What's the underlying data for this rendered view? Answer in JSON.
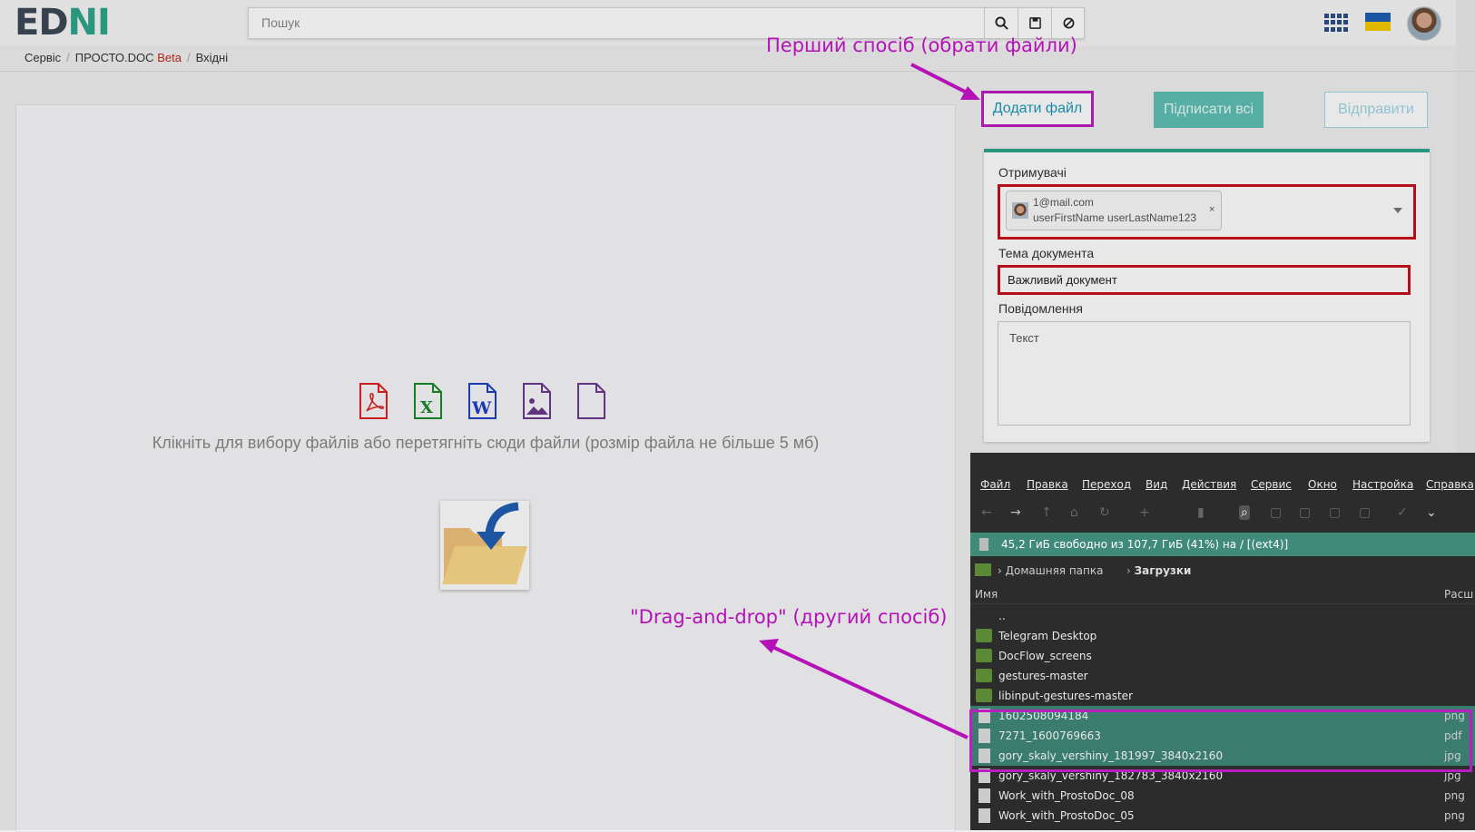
{
  "header": {
    "logo_left": "ED",
    "logo_right": "NI",
    "search_placeholder": "Пошук"
  },
  "breadcrumb": {
    "items": [
      "Сервіс",
      "ПРОСТО.DOC",
      "Вхідні"
    ],
    "beta": "Beta"
  },
  "dropzone": {
    "text": "Клікніть для вибору файлів або перетягніть сюди файли (розмір файла не більше 5 мб)"
  },
  "actions": {
    "add_file": "Додати файл",
    "sign_all": "Підписати всі",
    "send": "Відправити"
  },
  "form": {
    "recipients_label": "Отримувачі",
    "recipient_email": "1@mail.com",
    "recipient_name": "userFirstName userLastName123",
    "remove_symbol": "×",
    "subject_label": "Тема документа",
    "subject_value": "Важливий документ",
    "message_label": "Повідомлення",
    "message_value": "Текст"
  },
  "callouts": {
    "first": "Перший спосіб (обрати файли)",
    "second": "\"Drag-and-drop\" (другий спосіб)"
  },
  "file_manager": {
    "menu": [
      "Файл",
      "Правка",
      "Переход",
      "Вид",
      "Действия",
      "Сервис",
      "Окно",
      "Настройка",
      "Справка"
    ],
    "status": "45,2 ГиБ свободно из 107,7 ГиБ (41%) на / [(ext4)]",
    "path": [
      "Домашняя папка",
      "Загрузки"
    ],
    "col_name": "Имя",
    "col_ext": "Расш",
    "rows": [
      {
        "name": "..",
        "ext": "",
        "type": "up",
        "selected": false
      },
      {
        "name": "Telegram Desktop",
        "ext": "",
        "type": "folder",
        "selected": false
      },
      {
        "name": "DocFlow_screens",
        "ext": "",
        "type": "folder",
        "selected": false
      },
      {
        "name": "gestures-master",
        "ext": "",
        "type": "folder",
        "selected": false
      },
      {
        "name": "libinput-gestures-master",
        "ext": "",
        "type": "folder",
        "selected": false
      },
      {
        "name": "1602508094184",
        "ext": "png",
        "type": "file",
        "selected": true
      },
      {
        "name": "7271_1600769663",
        "ext": "pdf",
        "type": "file",
        "selected": true
      },
      {
        "name": "gory_skaly_vershiny_181997_3840x2160",
        "ext": "jpg",
        "type": "file",
        "selected": true
      },
      {
        "name": "gory_skaly_vershiny_182783_3840x2160",
        "ext": "jpg",
        "type": "file",
        "selected": false
      },
      {
        "name": "Work_with_ProstoDoc_08",
        "ext": "png",
        "type": "file",
        "selected": false
      },
      {
        "name": "Work_with_ProstoDoc_05",
        "ext": "png",
        "type": "file",
        "selected": false
      }
    ]
  },
  "colors": {
    "brand": "#2ea58a",
    "annotation": "#b511b8",
    "error_border": "#c8101c",
    "link": "#1b98b8",
    "selection": "#3a7d6e"
  }
}
